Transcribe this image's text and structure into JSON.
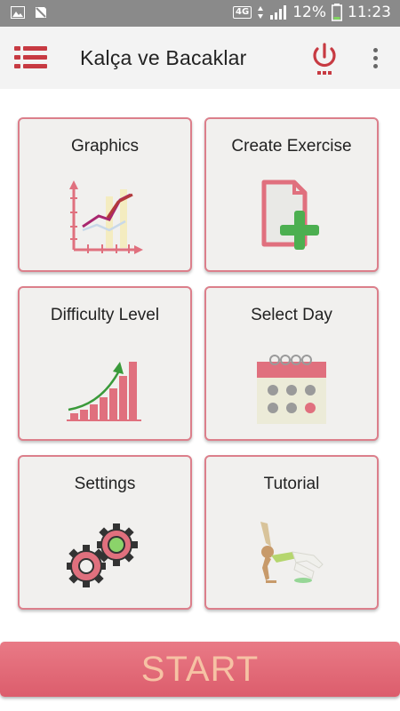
{
  "status_bar": {
    "network": "4G",
    "battery": "12%",
    "time": "11:23"
  },
  "app_bar": {
    "title": "Kalça ve Bacaklar",
    "menu_icon": "list-menu-icon",
    "power_icon": "power-icon",
    "overflow_icon": "more-vert-icon"
  },
  "tiles": [
    {
      "label": "Graphics",
      "icon": "line-chart-icon"
    },
    {
      "label": "Create Exercise",
      "icon": "add-document-icon"
    },
    {
      "label": "Difficulty Level",
      "icon": "rising-bars-icon"
    },
    {
      "label": "Select Day",
      "icon": "calendar-icon"
    },
    {
      "label": "Settings",
      "icon": "gears-icon"
    },
    {
      "label": "Tutorial",
      "icon": "exercise-figure-icon"
    }
  ],
  "start": {
    "label": "START"
  },
  "colors": {
    "accent": "#c73a42",
    "card_border": "#dc7f8b",
    "start_bg": "#e06a78",
    "start_text": "#f6c2a4",
    "plus": "#4caf50"
  }
}
